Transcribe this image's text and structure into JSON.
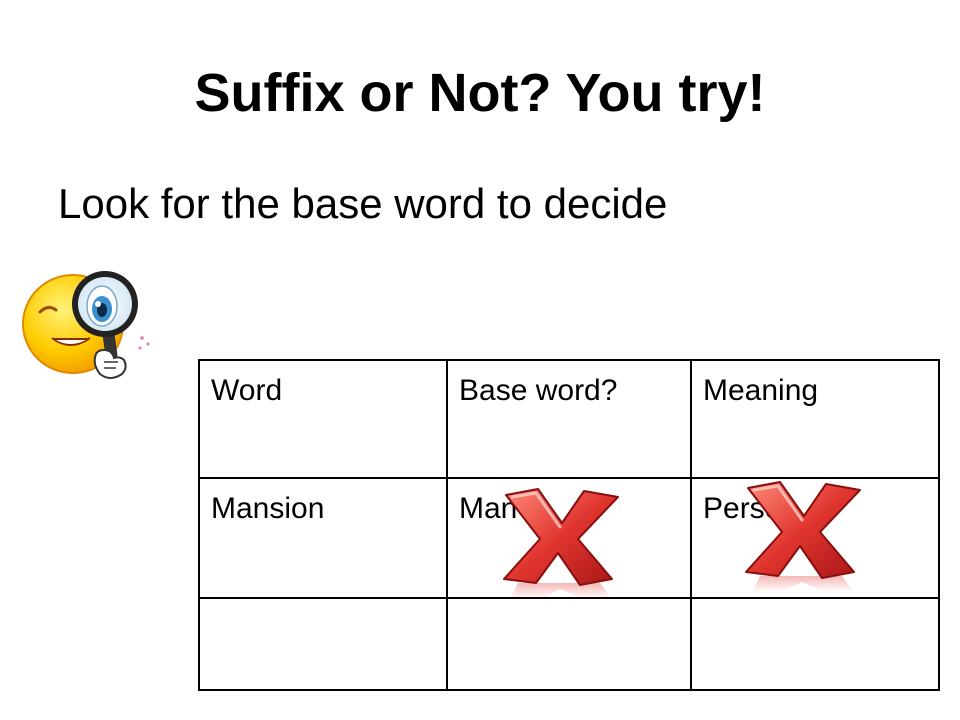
{
  "slide": {
    "title": "Suffix or Not? You try!",
    "subtitle": "Look for the base word to decide"
  },
  "table": {
    "headers": [
      "Word",
      "Base word?",
      "Meaning"
    ],
    "rows": [
      [
        "Mansion",
        "Man",
        "Person"
      ],
      [
        "",
        "",
        ""
      ]
    ]
  },
  "icons": {
    "mascot": "smiley-magnifying-glass-icon",
    "marks": [
      "red-x-icon",
      "red-x-icon"
    ]
  },
  "colors": {
    "x_red": "#e0352f",
    "smiley_yellow": "#ffcc00"
  }
}
